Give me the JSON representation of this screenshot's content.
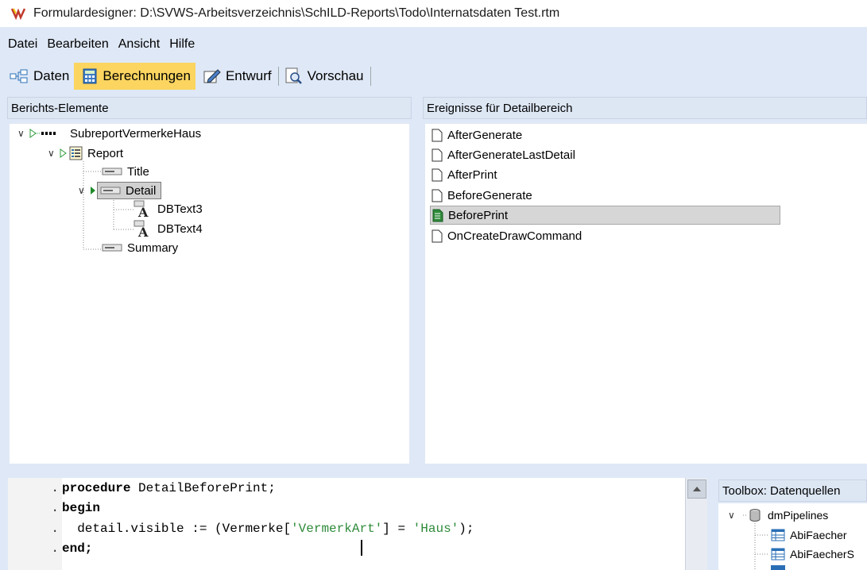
{
  "window": {
    "title": "Formulardesigner: D:\\SVWS-Arbeitsverzeichnis\\SchILD-Reports\\Todo\\Internatsdaten Test.rtm"
  },
  "menu": [
    "Datei",
    "Bearbeiten",
    "Ansicht",
    "Hilfe"
  ],
  "toolbar": {
    "daten": "Daten",
    "berechnungen": "Berechnungen",
    "entwurf": "Entwurf",
    "vorschau": "Vorschau",
    "active": "Berechnungen",
    "active_color": "#fbd560"
  },
  "left_panel": {
    "header": "Berichts-Elemente",
    "tree": {
      "root": "SubreportVermerkeHaus",
      "report": "Report",
      "title": "Title",
      "detail": "Detail",
      "dbtext3": "DBText3",
      "dbtext4": "DBText4",
      "summary": "Summary"
    }
  },
  "right_panel": {
    "header": "Ereignisse für Detailbereich",
    "events": [
      "AfterGenerate",
      "AfterGenerateLastDetail",
      "AfterPrint",
      "BeforeGenerate",
      "BeforePrint",
      "OnCreateDrawCommand"
    ],
    "selected": "BeforePrint"
  },
  "code": {
    "line1_kw": "procedure",
    "line1_rest": " DetailBeforePrint;",
    "line2_kw": "begin",
    "line3_a": "  detail.visible := (Vermerke[",
    "line3_str1": "'VermerkArt'",
    "line3_b": "] = ",
    "line3_str2": "'Haus'",
    "line3_c": ");",
    "line4_kw": "end;",
    "string_color": "#2e8b3a"
  },
  "toolbox": {
    "header": "Toolbox: Datenquellen",
    "root": "dmPipelines",
    "items": [
      "AbiFaecher",
      "AbiFaecherS"
    ]
  }
}
